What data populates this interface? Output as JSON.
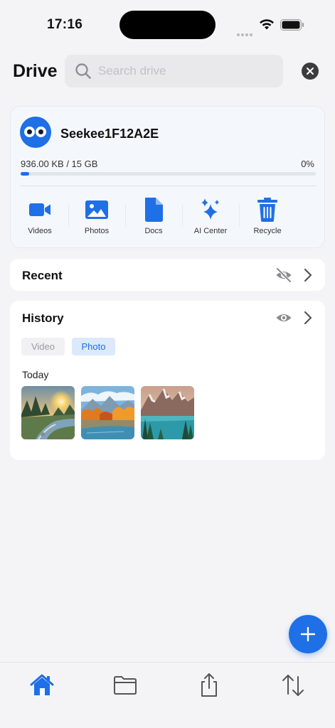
{
  "status_bar": {
    "time": "17:16"
  },
  "header": {
    "title": "Drive",
    "search": {
      "placeholder": "Search drive",
      "value": ""
    }
  },
  "account": {
    "name": "Seekee1F12A2E",
    "storage_used": "936.00 KB / 15 GB",
    "storage_percent": "0%",
    "progress_fraction": 0.01
  },
  "quick_actions": [
    {
      "label": "Videos",
      "icon": "video-icon"
    },
    {
      "label": "Photos",
      "icon": "image-icon"
    },
    {
      "label": "Docs",
      "icon": "document-icon"
    },
    {
      "label": "AI Center",
      "icon": "sparkle-icon"
    },
    {
      "label": "Recycle",
      "icon": "trash-icon"
    }
  ],
  "recent": {
    "title": "Recent",
    "visibility_icon": "eye-off-icon"
  },
  "history": {
    "title": "History",
    "visibility_icon": "eye-icon",
    "filters": [
      {
        "label": "Video",
        "selected": false
      },
      {
        "label": "Photo",
        "selected": true
      }
    ],
    "groups": [
      {
        "label": "Today",
        "items": [
          "river-sunset-photo",
          "autumn-lake-photo",
          "mountain-lake-photo"
        ]
      }
    ]
  },
  "fab": {
    "icon": "plus-icon"
  },
  "bottom_nav": [
    {
      "icon": "home-icon",
      "active": true
    },
    {
      "icon": "folder-icon",
      "active": false
    },
    {
      "icon": "share-icon",
      "active": false
    },
    {
      "icon": "transfer-icon",
      "active": false
    }
  ],
  "colors": {
    "accent": "#1f6fe6",
    "background": "#f4f4f6",
    "card": "#ffffff"
  }
}
